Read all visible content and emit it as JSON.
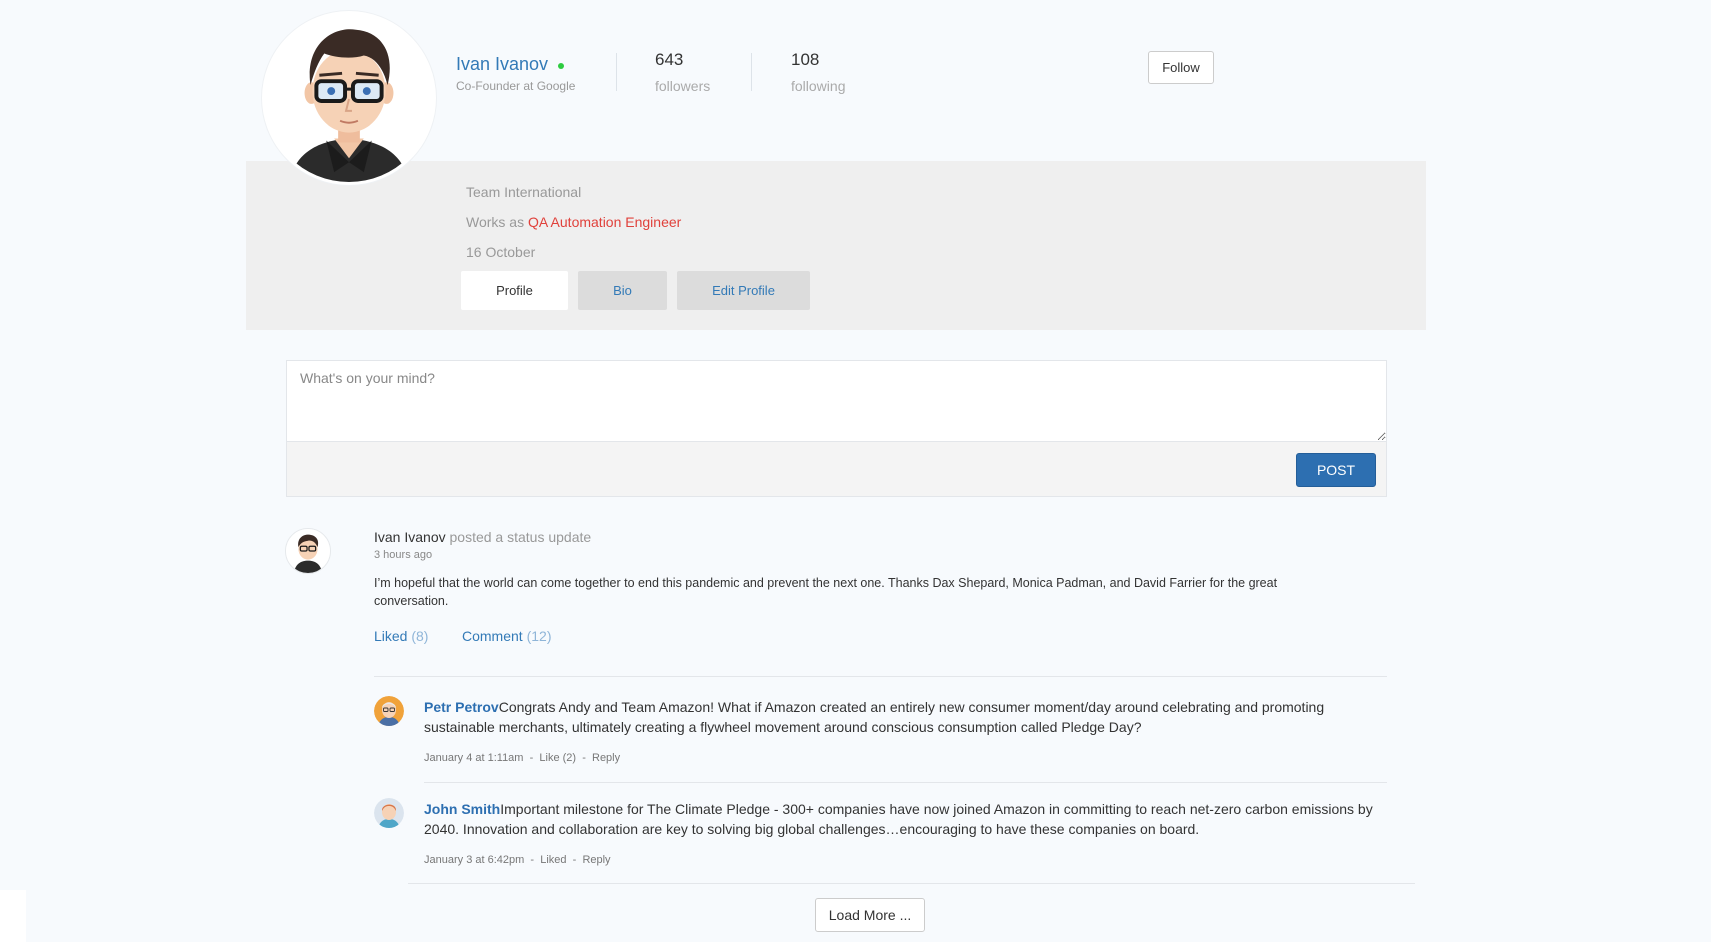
{
  "profile": {
    "name": "Ivan Ivanov",
    "role": "Co-Founder at Google",
    "online": true,
    "followers_count": "643",
    "followers_label": "followers",
    "following_count": "108",
    "following_label": "following",
    "follow_label": "Follow",
    "company": "Team International",
    "works_as_prefix": "Works as",
    "job_title": "QA Automation Engineer",
    "date": "16 October",
    "tabs": [
      {
        "label": "Profile",
        "active": true
      },
      {
        "label": "Bio",
        "active": false
      },
      {
        "label": "Edit Profile",
        "active": false
      }
    ]
  },
  "composer": {
    "placeholder": "What's on your mind?",
    "post_label": "POST"
  },
  "post": {
    "author": "Ivan Ivanov",
    "action_text": "posted a status update",
    "time": "3 hours ago",
    "body": "I’m hopeful that the world can come together to end this pandemic and prevent the next one. Thanks Dax Shepard, Monica Padman, and David Farrier for the great conversation.",
    "liked_label": "Liked",
    "liked_count": "(8)",
    "comment_label": "Comment",
    "comment_count": "(12)"
  },
  "comments": [
    {
      "author": "Petr Petrov",
      "text": "Congrats Andy and Team Amazon! What if Amazon created an entirely new consumer moment/day around celebrating and promoting sustainable merchants, ultimately creating a flywheel movement around conscious consumption called Pledge Day?",
      "date": "January 4 at 1:11am",
      "like_label": "Like (2)",
      "reply_label": "Reply",
      "sep": "-"
    },
    {
      "author": "John Smith",
      "text": "Important milestone for The Climate Pledge - 300+ companies have now joined Amazon in committing to reach net-zero carbon emissions by 2040. Innovation and collaboration are key to solving big global challenges…encouraging to have these companies on board.",
      "date": "January 3 at 6:42pm",
      "like_label": "Liked",
      "reply_label": "Reply",
      "sep": "-"
    }
  ],
  "load_more_label": "Load More ...",
  "colors": {
    "link": "#337ab7",
    "job": "#e0413b",
    "online": "#2ecc40",
    "post_button": "#2d6fb1"
  }
}
